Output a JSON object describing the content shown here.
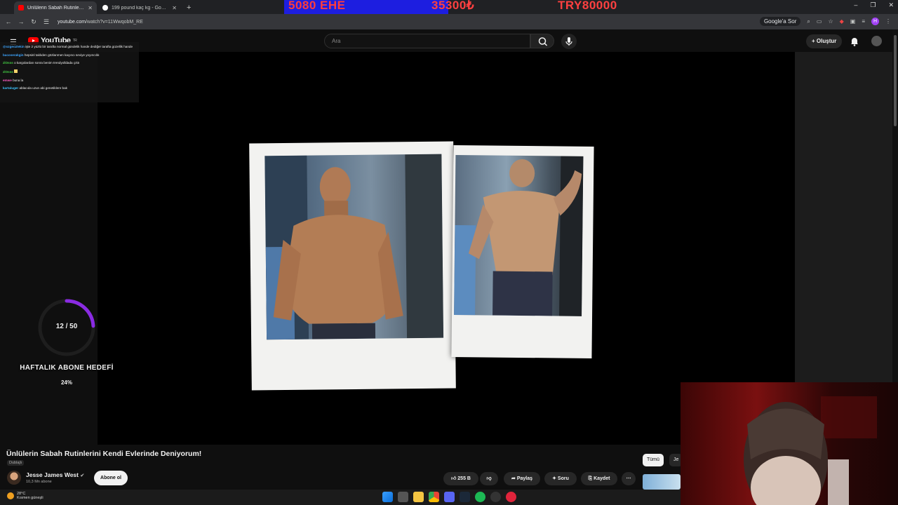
{
  "browser": {
    "tabs": [
      {
        "title": "Ünlülerin Sabah Rutinlerini Ken",
        "active": true
      },
      {
        "title": "199 pound kaç kg - Google'da",
        "active": false
      }
    ],
    "url_domain": "youtube.com",
    "url_path": "/watch?v=11WwqobM_RE",
    "google_sor": "Google'a Sor",
    "profile_letter": "H"
  },
  "stream_banner": {
    "left": "5080 EHE",
    "mid": "35300₺",
    "right": "TRY80000"
  },
  "youtube": {
    "region": "TR",
    "search_placeholder": "Ara",
    "create_label": "Oluştur"
  },
  "chat": [
    {
      "user": "@ozgeoztekin",
      "color": "#3ea6ff",
      "text": "işte 2 yüzlü bir tarafta normal gündelik hande dediğer tarafta güzellik hande"
    },
    {
      "user": "bacoserakgin",
      "color": "#3ea6ff",
      "text": "hepsinl taklıden gözlarımen kaçıncı seviye yoyıncılık"
    },
    {
      "user": "zlOsss",
      "color": "#44d144",
      "text": "o kargolardan sonra benim trendyolldada çıktı"
    },
    {
      "user": "zlOsss",
      "color": "#44d144",
      "text": ""
    },
    {
      "user": "emwe",
      "color": "#ff5ec4",
      "text": "buna la"
    },
    {
      "user": "kartaluger",
      "color": "#3ec3ff",
      "text": "ablacıda uzun abi genetiklere bak"
    }
  ],
  "goal": {
    "count": "12 / 50",
    "title": "HAFTALIK ABONE HEDEFİ",
    "percent": "24%",
    "progress": 0.24
  },
  "video": {
    "title": "Ünlülerin Sabah Rutinlerini Kendi Evlerinde Deniyorum!",
    "dubbed": "Dublajlı",
    "channel": "Jesse James West",
    "subscribers": "10,3 Mn abone",
    "subscribe_label": "Abone ol",
    "likes": "255 B",
    "share_label": "Paylaş",
    "ask_label": "Soru",
    "save_label": "Kaydet",
    "chips": [
      "Tümü",
      "Je"
    ]
  },
  "taskbar": {
    "temp": "28°C",
    "weather": "Kısmen güneşli"
  }
}
